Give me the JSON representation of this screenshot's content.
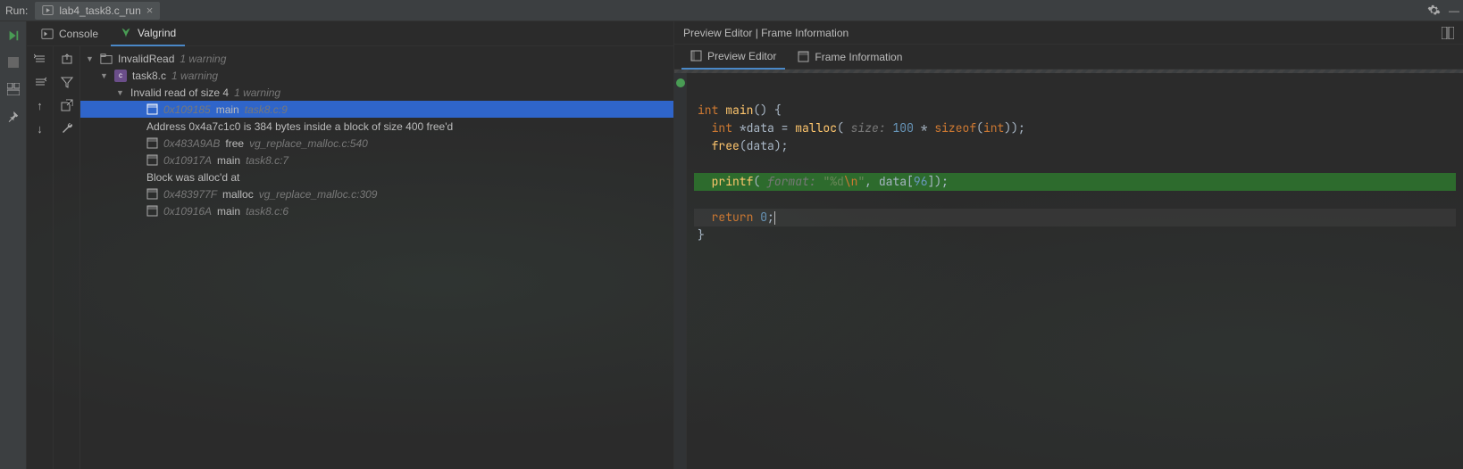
{
  "header": {
    "run_label": "Run:",
    "run_config": "lab4_task8.c_run"
  },
  "left": {
    "tabs": {
      "console": "Console",
      "valgrind": "Valgrind"
    },
    "tree": {
      "root": {
        "label": "InvalidRead",
        "note": "1 warning"
      },
      "file": {
        "label": "task8.c",
        "note": "1 warning"
      },
      "issue": {
        "label": "Invalid read of size 4",
        "note": "1 warning"
      },
      "f0": {
        "addr": "0x109185",
        "fn": "main",
        "loc": "task8.c:9"
      },
      "msg1": "Address 0x4a7c1c0 is 384 bytes inside a block of size 400 free'd",
      "f1": {
        "addr": "0x483A9AB",
        "fn": "free",
        "loc": "vg_replace_malloc.c:540"
      },
      "f2": {
        "addr": "0x10917A",
        "fn": "main",
        "loc": "task8.c:7"
      },
      "msg2": "Block was alloc'd at",
      "f3": {
        "addr": "0x483977F",
        "fn": "malloc",
        "loc": "vg_replace_malloc.c:309"
      },
      "f4": {
        "addr": "0x10916A",
        "fn": "main",
        "loc": "task8.c:6"
      }
    }
  },
  "right": {
    "title": "Preview Editor | Frame Information",
    "tabs": {
      "preview": "Preview Editor",
      "frame": "Frame Information"
    },
    "code": {
      "l1_kw1": "int",
      "l1_fn": "main",
      "l1_rest": "() {",
      "l2_kw1": "int",
      "l2_rest1": " *data = ",
      "l2_fn": "malloc",
      "l2_hint": "size:",
      "l2_num1": "100",
      "l2_kw2": "sizeof",
      "l2_kw3": "int",
      "l2_tail": "));",
      "l3_fn": "free",
      "l3_arg": "(data);",
      "l5_fn": "printf",
      "l5_hint": "format:",
      "l5_str1": "\"%d",
      "l5_esc": "\\n",
      "l5_str2": "\"",
      "l5_rest": ", data[",
      "l5_num": "96",
      "l5_tail": "]);",
      "l7_kw": "return",
      "l7_num": "0",
      "l7_tail": ";",
      "l8": "}"
    }
  }
}
